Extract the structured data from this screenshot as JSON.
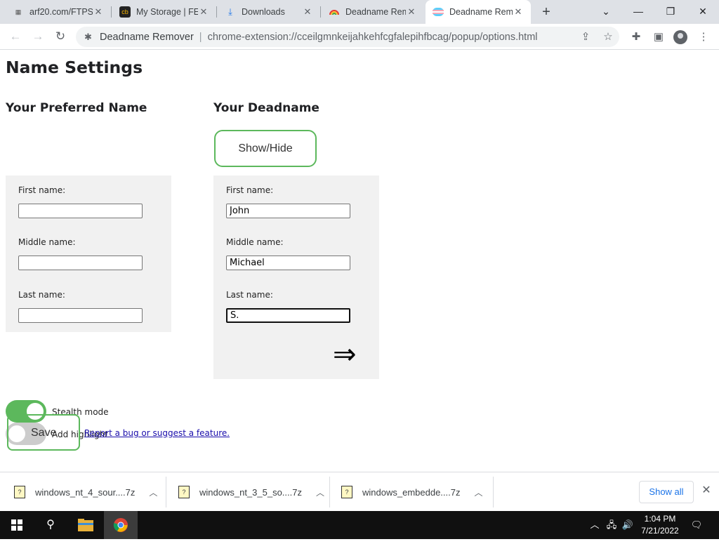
{
  "browser": {
    "tabs": [
      {
        "title": "arf20.com/FTPS",
        "icon": "arf-favicon"
      },
      {
        "title": "My Storage | FE",
        "icon": "storage-favicon"
      },
      {
        "title": "Downloads",
        "icon": "download-icon"
      },
      {
        "title": "Deadname Rem",
        "icon": "rainbow-favicon"
      },
      {
        "title": "Deadname Rem",
        "icon": "trans-flag-favicon",
        "active": true
      }
    ],
    "address": {
      "site": "Deadname Remover",
      "url": "chrome-extension://cceilgmnkeijahkehfcgfalepihfbcag/popup/options.html"
    }
  },
  "page": {
    "title": "Name Settings",
    "preferred": {
      "heading": "Your Preferred Name",
      "first_label": "First name:",
      "first_value": "",
      "middle_label": "Middle name:",
      "middle_value": "",
      "last_label": "Last name:",
      "last_value": ""
    },
    "deadname": {
      "heading": "Your Deadname",
      "show_hide": "Show/Hide",
      "first_label": "First name:",
      "first_value": "John",
      "middle_label": "Middle name:",
      "middle_value": "Michael",
      "last_label": "Last name:",
      "last_value": "S.",
      "arrow": "⇒"
    },
    "stealth_label": "Stealth mode",
    "stealth_on": true,
    "highlight_label": "Add highlight",
    "highlight_on": false,
    "save": "Save",
    "bug_link": "Report a bug or suggest a feature."
  },
  "downloads": {
    "items": [
      {
        "name": "windows_nt_4_sour....7z"
      },
      {
        "name": "windows_nt_3_5_so....7z"
      },
      {
        "name": "windows_embedde....7z"
      }
    ],
    "show_all": "Show all"
  },
  "taskbar": {
    "time": "1:04 PM",
    "date": "7/21/2022"
  },
  "colors": {
    "accent_green": "#5cb85c",
    "tab_strip": "#dee1e6",
    "taskbar": "#101010"
  }
}
